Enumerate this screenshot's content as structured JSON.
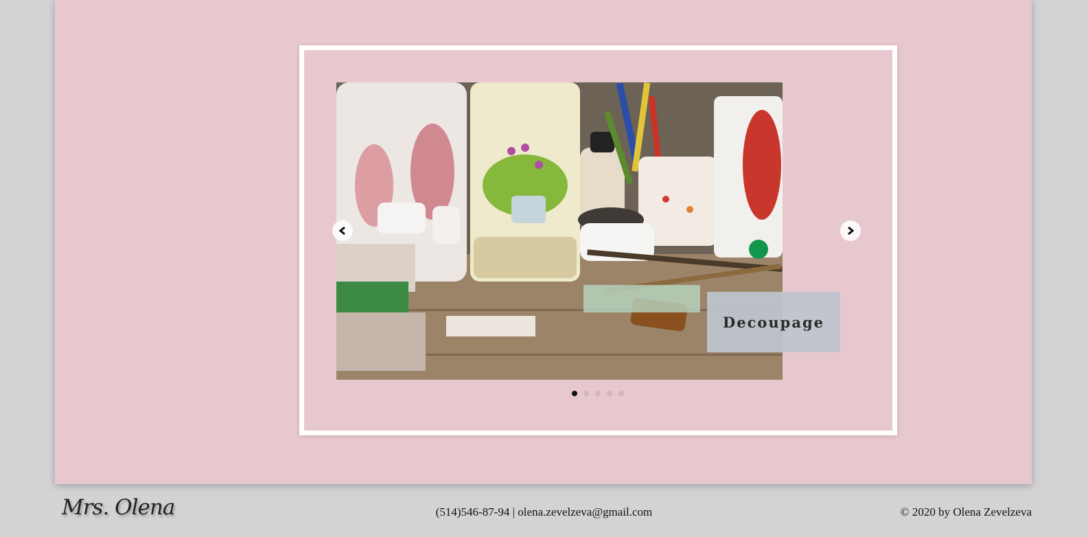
{
  "gallery": {
    "caption": "Decoupage",
    "slide_count": 5,
    "active_slide": 1,
    "prev_icon": "chevron-left-icon",
    "next_icon": "chevron-right-icon"
  },
  "footer": {
    "logo": "Mrs. Olena",
    "phone": "(514)546-87-94",
    "separator": "|",
    "email": "olena.zevelzeva@gmail.com",
    "copyright": "© 2020 by Olena Zevelzeva"
  },
  "colors": {
    "page_background": "#d3d3d5",
    "content_background": "#e8c8cf",
    "frame": "#ffffff",
    "caption_background": "#bec4ce"
  }
}
